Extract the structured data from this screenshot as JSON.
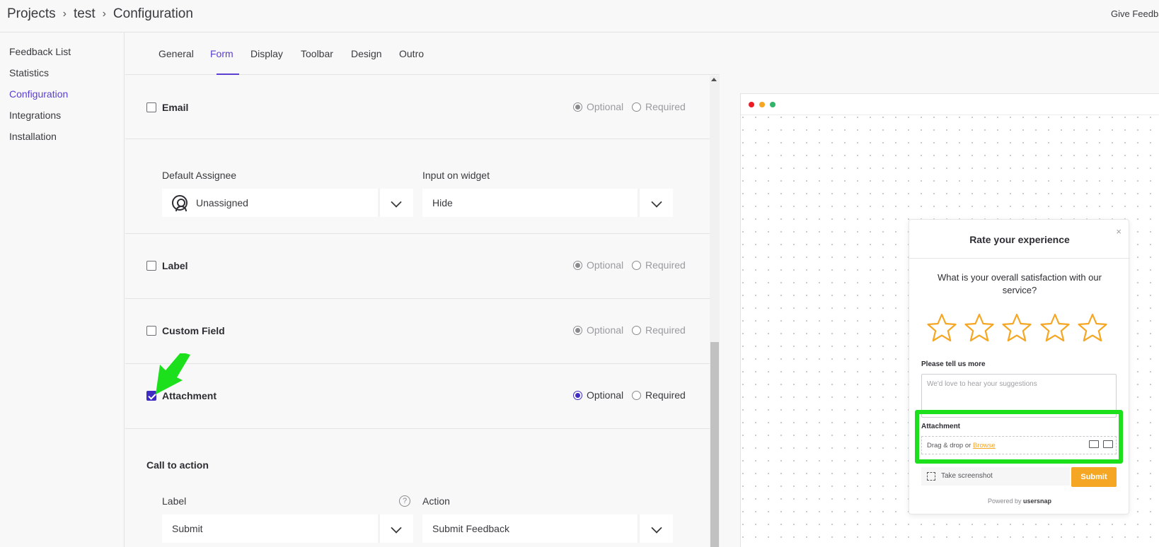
{
  "header": {
    "breadcrumb": [
      "Projects",
      "test",
      "Configuration"
    ],
    "give_feedback": "Give Feedback"
  },
  "sidebar": {
    "items": [
      {
        "label": "Feedback List"
      },
      {
        "label": "Statistics"
      },
      {
        "label": "Configuration"
      },
      {
        "label": "Integrations"
      },
      {
        "label": "Installation"
      }
    ]
  },
  "tabs": [
    "General",
    "Form",
    "Display",
    "Toolbar",
    "Design",
    "Outro"
  ],
  "form": {
    "optional_label": "Optional",
    "required_label": "Required",
    "email": {
      "label": "Email",
      "checked": false,
      "mode": "Optional"
    },
    "default_assignee": {
      "label": "Default Assignee",
      "value": "Unassigned"
    },
    "input_on_widget": {
      "label": "Input on widget",
      "value": "Hide"
    },
    "label_field": {
      "label": "Label",
      "checked": false,
      "mode": "Optional"
    },
    "custom_field": {
      "label": "Custom Field",
      "checked": false,
      "mode": "Optional"
    },
    "attachment": {
      "label": "Attachment",
      "checked": true,
      "mode": "Optional"
    },
    "cta": {
      "heading": "Call to action",
      "label_title": "Label",
      "label_value": "Submit",
      "action_title": "Action",
      "action_value": "Submit Feedback",
      "help": "?"
    }
  },
  "widget": {
    "title": "Rate your experience",
    "close": "×",
    "question": "What is your overall satisfaction with our service?",
    "rating": {
      "value": 0,
      "max": 5
    },
    "more_label": "Please tell us more",
    "placeholder": "We'd love to hear your suggestions",
    "attachment_title": "Attachment",
    "drop_text": "Drag & drop or ",
    "browse": "Browse",
    "screenshot": "Take screenshot",
    "submit": "Submit",
    "powered": "Powered by",
    "brand": "usersnap"
  },
  "colors": {
    "accent": "#5a3fd0",
    "checkbox": "#3f2cc2",
    "star": "#f5a623",
    "highlight": "#1de01d",
    "dot_red": "#ec1c24",
    "dot_yellow": "#f5a623",
    "dot_green": "#34b36b"
  }
}
